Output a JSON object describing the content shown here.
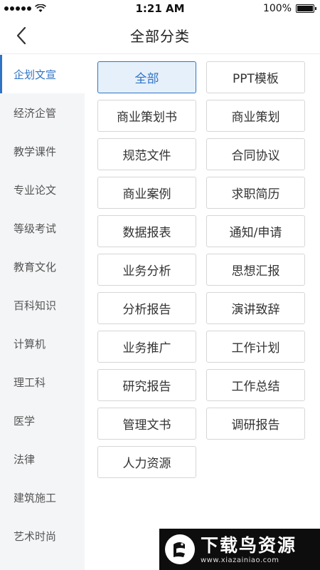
{
  "status_bar": {
    "time": "1:21 AM",
    "battery": "100%",
    "battery_level": 1.0
  },
  "nav": {
    "title": "全部分类",
    "back_icon": "chevron-left-icon"
  },
  "sidebar": {
    "items": [
      {
        "label": "企划文宣",
        "active": true
      },
      {
        "label": "经济企管",
        "active": false
      },
      {
        "label": "教学课件",
        "active": false
      },
      {
        "label": "专业论文",
        "active": false
      },
      {
        "label": "等级考试",
        "active": false
      },
      {
        "label": "教育文化",
        "active": false
      },
      {
        "label": "百科知识",
        "active": false
      },
      {
        "label": "计算机",
        "active": false
      },
      {
        "label": "理工科",
        "active": false
      },
      {
        "label": "医学",
        "active": false
      },
      {
        "label": "法律",
        "active": false
      },
      {
        "label": "建筑施工",
        "active": false
      },
      {
        "label": "艺术时尚",
        "active": false
      }
    ]
  },
  "categories": [
    {
      "label": "全部",
      "active": true
    },
    {
      "label": "PPT模板",
      "active": false
    },
    {
      "label": "商业策划书",
      "active": false
    },
    {
      "label": "商业策划",
      "active": false
    },
    {
      "label": "规范文件",
      "active": false
    },
    {
      "label": "合同协议",
      "active": false
    },
    {
      "label": "商业案例",
      "active": false
    },
    {
      "label": "求职简历",
      "active": false
    },
    {
      "label": "数据报表",
      "active": false
    },
    {
      "label": "通知/申请",
      "active": false
    },
    {
      "label": "业务分析",
      "active": false
    },
    {
      "label": "思想汇报",
      "active": false
    },
    {
      "label": "分析报告",
      "active": false
    },
    {
      "label": "演讲致辞",
      "active": false
    },
    {
      "label": "业务推广",
      "active": false
    },
    {
      "label": "工作计划",
      "active": false
    },
    {
      "label": "研究报告",
      "active": false
    },
    {
      "label": "工作总结",
      "active": false
    },
    {
      "label": "管理文书",
      "active": false
    },
    {
      "label": "调研报告",
      "active": false
    },
    {
      "label": "人力资源",
      "active": false
    }
  ],
  "watermark": {
    "title": "下载鸟资源",
    "url": "www.xiazainiao.com"
  },
  "colors": {
    "accent": "#2f73c6",
    "active_bg": "#e6f0fb",
    "sidebar_bg": "#f4f5f7"
  }
}
